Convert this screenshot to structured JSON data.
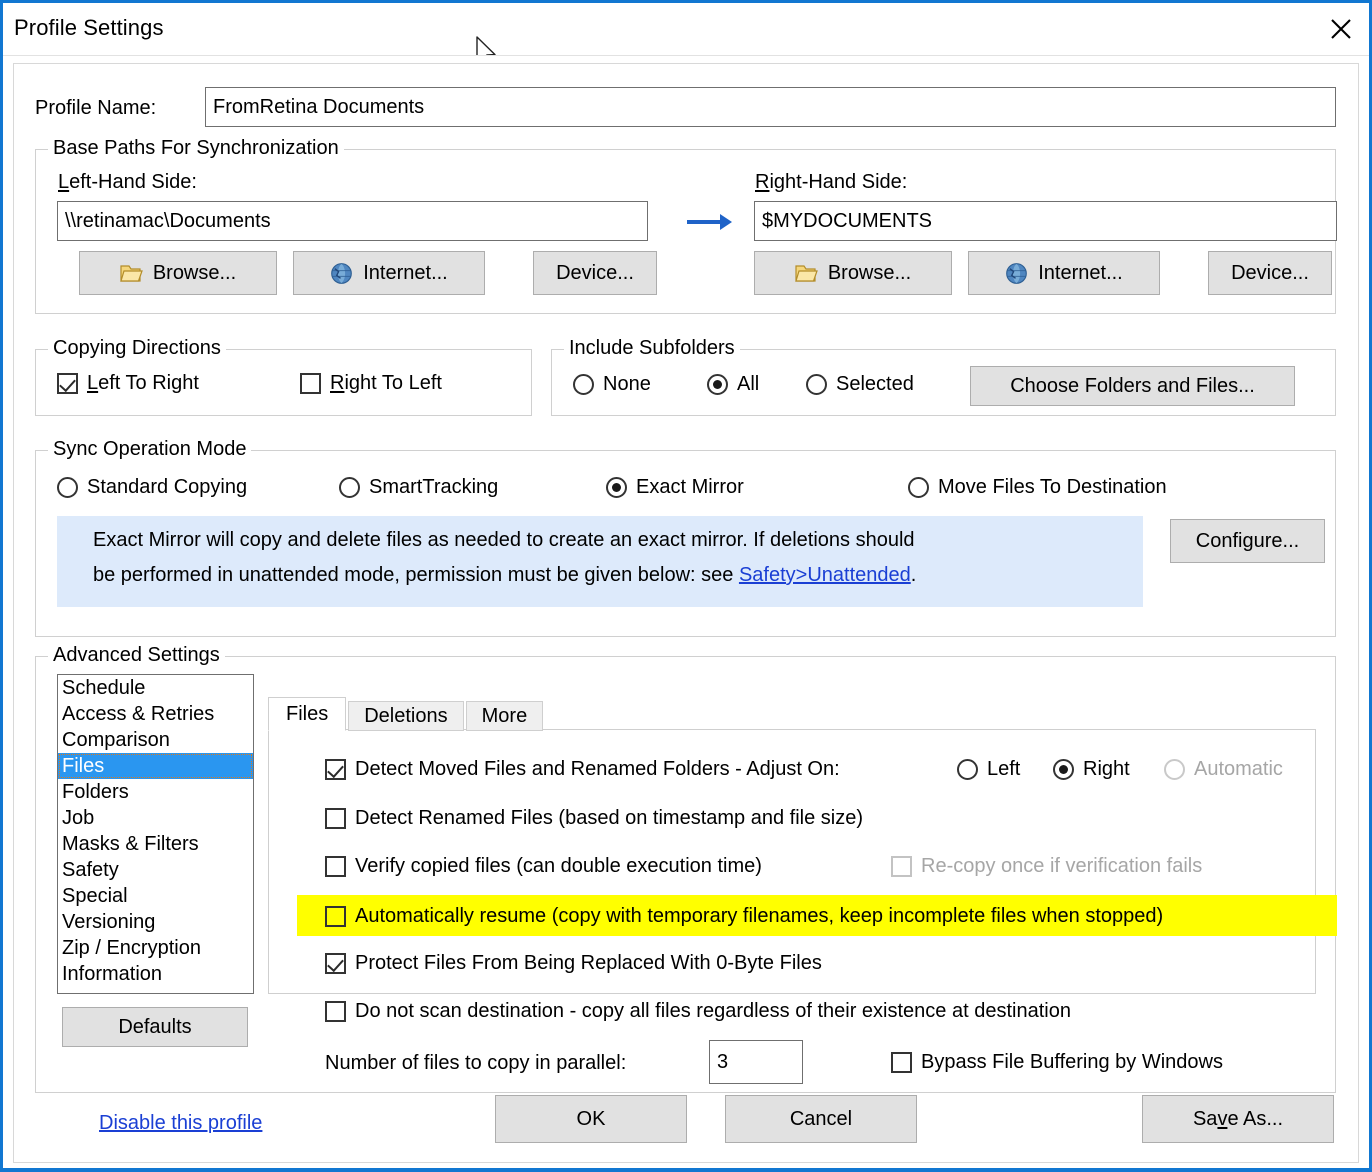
{
  "window": {
    "title": "Profile Settings",
    "close_icon": "close-icon",
    "accent_color": "#1177d1"
  },
  "profile_name": {
    "label": "Profile Name:",
    "value": "FromRetina Documents"
  },
  "base_paths": {
    "caption": "Base Paths For Synchronization",
    "arrow_icon": "arrow-right-icon",
    "left": {
      "label": "Left-Hand Side:",
      "value": "\\\\retinamac\\Documents",
      "browse_label": "Browse...",
      "internet_label": "Internet...",
      "device_label": "Device...",
      "browse_icon": "folder-icon",
      "internet_icon": "globe-icon"
    },
    "right": {
      "label": "Right-Hand Side:",
      "value": "$MYDOCUMENTS",
      "browse_label": "Browse...",
      "internet_label": "Internet...",
      "device_label": "Device...",
      "browse_icon": "folder-icon",
      "internet_icon": "globe-icon"
    }
  },
  "copying_directions": {
    "caption": "Copying Directions",
    "left_to_right": {
      "label": "Left To Right",
      "checked": true
    },
    "right_to_left": {
      "label": "Right To Left",
      "checked": false
    }
  },
  "include_subfolders": {
    "caption": "Include Subfolders",
    "options": [
      {
        "label": "None",
        "selected": false
      },
      {
        "label": "All",
        "selected": true
      },
      {
        "label": "Selected",
        "selected": false
      }
    ],
    "choose_button": "Choose Folders and Files..."
  },
  "sync_mode": {
    "caption": "Sync Operation Mode",
    "options": [
      {
        "label": "Standard Copying",
        "selected": false
      },
      {
        "label": "SmartTracking",
        "selected": false
      },
      {
        "label": "Exact Mirror",
        "selected": true
      },
      {
        "label": "Move Files To Destination",
        "selected": false
      }
    ],
    "configure_button": "Configure...",
    "info_line1": "Exact Mirror will copy and delete files as needed to create an exact mirror. If deletions should",
    "info_line2_pre": "be performed in unattended mode, permission must be given below: see ",
    "info_link": "Safety>Unattended",
    "info_line2_post": ".",
    "info_bg": "#ddeafb"
  },
  "advanced_settings": {
    "caption": "Advanced Settings",
    "items": [
      {
        "label": "Schedule",
        "selected": false
      },
      {
        "label": "Access & Retries",
        "selected": false
      },
      {
        "label": "Comparison",
        "selected": false
      },
      {
        "label": "Files",
        "selected": true
      },
      {
        "label": "Folders",
        "selected": false
      },
      {
        "label": "Job",
        "selected": false
      },
      {
        "label": "Masks & Filters",
        "selected": false
      },
      {
        "label": "Safety",
        "selected": false
      },
      {
        "label": "Special",
        "selected": false
      },
      {
        "label": "Versioning",
        "selected": false
      },
      {
        "label": "Zip / Encryption",
        "selected": false
      },
      {
        "label": "Information",
        "selected": false
      }
    ],
    "selected_color": "#2a96f0",
    "defaults_button": "Defaults"
  },
  "tabs": [
    {
      "label": "Files",
      "active": true
    },
    {
      "label": "Deletions",
      "active": false
    },
    {
      "label": "More",
      "active": false
    }
  ],
  "files_tab": {
    "detect_moved": {
      "label": "Detect Moved Files and Renamed Folders - Adjust On:",
      "checked": true,
      "adjust_options": [
        {
          "label": "Left",
          "selected": false,
          "disabled": false
        },
        {
          "label": "Right",
          "selected": true,
          "disabled": false
        },
        {
          "label": "Automatic",
          "selected": false,
          "disabled": true
        }
      ]
    },
    "detect_renamed": {
      "label": "Detect Renamed Files (based on timestamp and file size)",
      "checked": false
    },
    "verify_copied": {
      "label": "Verify copied files (can double execution time)",
      "checked": false
    },
    "recopy_once": {
      "label": "Re-copy once if verification fails",
      "checked": false,
      "disabled": true
    },
    "auto_resume": {
      "label": "Automatically resume (copy with temporary filenames, keep incomplete files when stopped)",
      "checked": false,
      "highlighted": true,
      "highlight_color": "#ffff00"
    },
    "protect_files": {
      "label": "Protect Files From Being Replaced With 0-Byte Files",
      "checked": true
    },
    "no_scan_destination": {
      "label": "Do not scan destination - copy all files regardless of their existence at destination",
      "checked": false
    },
    "parallel": {
      "label": "Number of files to copy in parallel:",
      "value": "3"
    },
    "bypass_buffering": {
      "label": "Bypass File Buffering by Windows",
      "checked": false
    }
  },
  "footer": {
    "disable_link": "Disable this profile",
    "ok_button": "OK",
    "cancel_button": "Cancel",
    "save_as_button": "Save As..."
  }
}
